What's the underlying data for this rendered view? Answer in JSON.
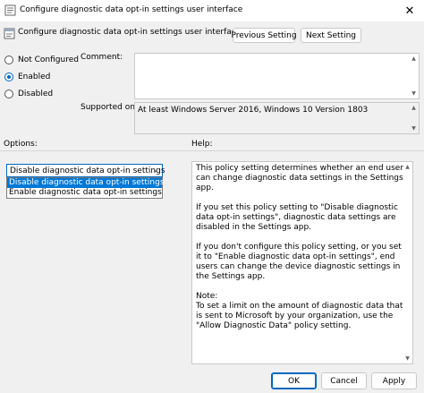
{
  "window": {
    "title": "Configure diagnostic data opt-in settings user interface",
    "close_glyph": "✕"
  },
  "header": {
    "title": "Configure diagnostic data opt-in settings user interface"
  },
  "nav": {
    "previous_label": "Previous Setting",
    "next_label": "Next Setting"
  },
  "state_options": [
    {
      "label": "Not Configured",
      "checked": false
    },
    {
      "label": "Enabled",
      "checked": true
    },
    {
      "label": "Disabled",
      "checked": false
    }
  ],
  "comment": {
    "label": "Comment:",
    "value": ""
  },
  "supported": {
    "label": "Supported on:",
    "value": "At least Windows Server 2016, Windows 10 Version 1803"
  },
  "options": {
    "label": "Options:",
    "combo_value": "Disable diagnostic data opt-in settings",
    "dropdown_items": [
      "Disable diagnostic data opt-in settings",
      "Enable diagnostic data opt-in settings"
    ]
  },
  "help": {
    "label": "Help:",
    "paragraphs": [
      "This policy setting determines whether an end user can change diagnostic data settings in the Settings app.",
      "If you set this policy setting to \"Disable diagnostic data opt-in settings\", diagnostic data settings are disabled in the Settings app.",
      "If you don't configure this policy setting, or you set it to \"Enable diagnostic data opt-in settings\", end users can change the device diagnostic settings in the Settings app.",
      "Note:\nTo set a limit on the amount of diagnostic data that is sent to Microsoft by your organization, use the \"Allow Diagnostic Data\" policy setting."
    ]
  },
  "footer": {
    "ok_label": "OK",
    "cancel_label": "Cancel",
    "apply_label": "Apply"
  },
  "colors": {
    "accent": "#0067c0",
    "selection": "#0078d7"
  }
}
